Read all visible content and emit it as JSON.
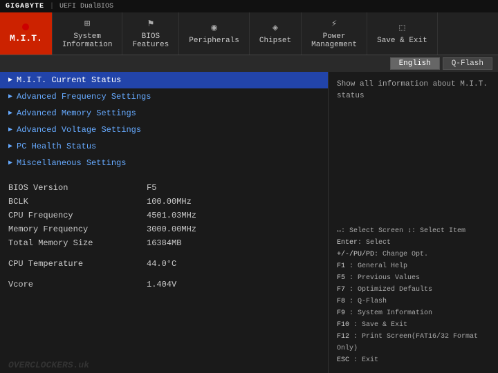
{
  "topbar": {
    "brand": "GIGABYTE",
    "separator": "|",
    "uefi": "UEFI DualBIOS"
  },
  "nav": {
    "items": [
      {
        "id": "mit",
        "label": "M.I.T.",
        "icon": "circle",
        "active": true
      },
      {
        "id": "system-info",
        "label": "System\nInformation",
        "icon": "ℹ",
        "active": false
      },
      {
        "id": "bios-features",
        "label": "BIOS\nFeatures",
        "icon": "⚙",
        "active": false
      },
      {
        "id": "peripherals",
        "label": "Peripherals",
        "icon": "⚙",
        "active": false
      },
      {
        "id": "chipset",
        "label": "Chipset",
        "icon": "◈",
        "active": false
      },
      {
        "id": "power",
        "label": "Power\nManagement",
        "icon": "⚡",
        "active": false
      },
      {
        "id": "save-exit",
        "label": "Save & Exit",
        "icon": "⎋",
        "active": false
      }
    ]
  },
  "langbar": {
    "english_label": "English",
    "qflash_label": "Q-Flash"
  },
  "menu": {
    "items": [
      {
        "id": "mit-current",
        "label": "M.I.T. Current Status",
        "active": true,
        "arrow": "▶"
      },
      {
        "id": "adv-freq",
        "label": "Advanced Frequency Settings",
        "active": false,
        "arrow": "▶"
      },
      {
        "id": "adv-mem",
        "label": "Advanced Memory Settings",
        "active": false,
        "arrow": "▶"
      },
      {
        "id": "adv-volt",
        "label": "Advanced Voltage Settings",
        "active": false,
        "arrow": "▶"
      },
      {
        "id": "pc-health",
        "label": "PC Health Status",
        "active": false,
        "arrow": "▶"
      },
      {
        "id": "misc",
        "label": "Miscellaneous Settings",
        "active": false,
        "arrow": "▶"
      }
    ]
  },
  "info": {
    "rows": [
      {
        "label": "BIOS Version",
        "value": "F5"
      },
      {
        "label": "BCLK",
        "value": "100.00MHz"
      },
      {
        "label": "CPU Frequency",
        "value": "4501.03MHz"
      },
      {
        "label": "Memory Frequency",
        "value": "3000.00MHz"
      },
      {
        "label": "Total Memory Size",
        "value": "16384MB"
      },
      {
        "spacer": true
      },
      {
        "label": "CPU Temperature",
        "value": "44.0°C"
      },
      {
        "spacer": true
      },
      {
        "label": "Vcore",
        "value": "1.404V"
      }
    ]
  },
  "helptext": "Show all information about M.I.T. status",
  "shortcuts": [
    {
      "key": "↔",
      "desc": ": Select Screen  ↕: Select Item"
    },
    {
      "key": "Enter",
      "desc": ": Select"
    },
    {
      "key": "+/-/PU/PD",
      "desc": ": Change Opt."
    },
    {
      "key": "F1",
      "desc": ": General Help"
    },
    {
      "key": "F5",
      "desc": ": Previous Values"
    },
    {
      "key": "F7",
      "desc": ": Optimized Defaults"
    },
    {
      "key": "F8",
      "desc": ": Q-Flash"
    },
    {
      "key": "F9",
      "desc": ": System Information"
    },
    {
      "key": "F10",
      "desc": ": Save & Exit"
    },
    {
      "key": "F12",
      "desc": ": Print Screen(FAT16/32 Format Only)"
    },
    {
      "key": "ESC",
      "desc": ": Exit"
    }
  ],
  "footer": {
    "watermark": "OVERCLOCKERS.uk"
  }
}
